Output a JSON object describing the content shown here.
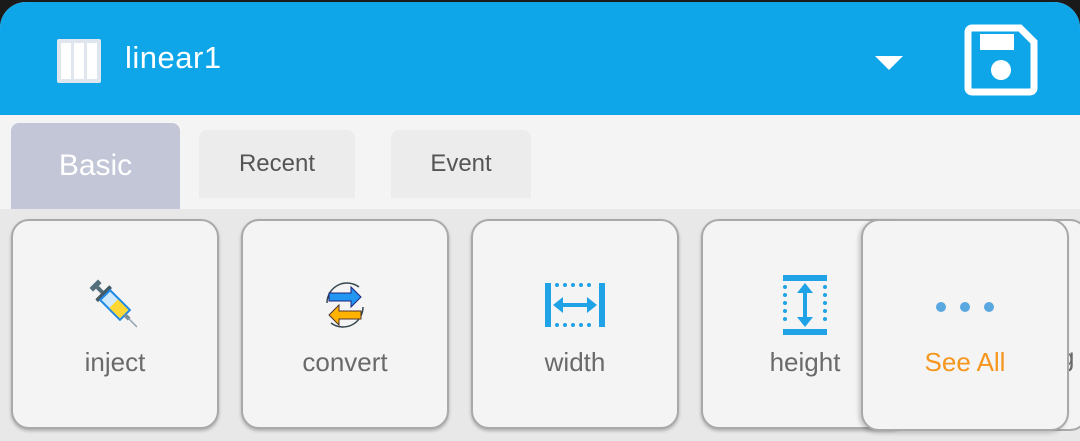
{
  "header": {
    "title": "linear1",
    "layout_icon": "layout-columns-icon",
    "dropdown_icon": "caret-down-icon",
    "save_icon": "floppy-save-icon",
    "bg_color": "#0ea6e8"
  },
  "tabs": [
    {
      "label": "Basic",
      "active": true
    },
    {
      "label": "Recent",
      "active": false
    },
    {
      "label": "Event",
      "active": false
    }
  ],
  "blocks": [
    {
      "label": "inject",
      "icon": "syringe-icon"
    },
    {
      "label": "convert",
      "icon": "convert-arrows-icon"
    },
    {
      "label": "width",
      "icon": "width-icon"
    },
    {
      "label": "height",
      "icon": "height-icon"
    }
  ],
  "see_all": {
    "label": "See All",
    "icon": "more-dots-icon",
    "color": "#f5961d"
  },
  "peek_text": "g"
}
